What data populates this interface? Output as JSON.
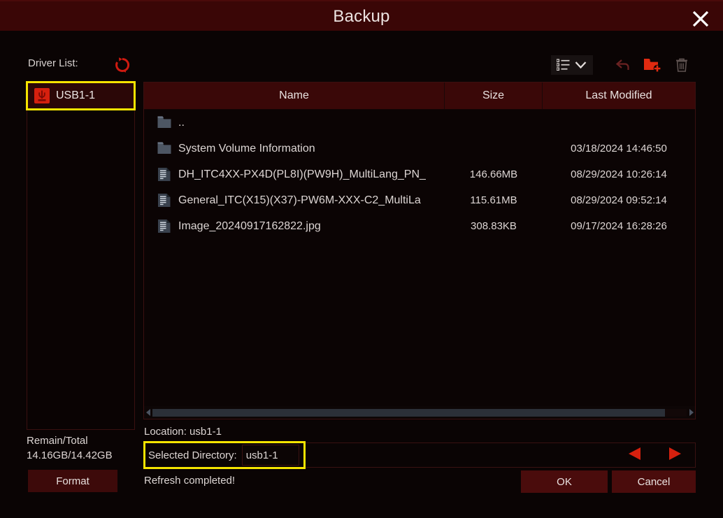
{
  "window": {
    "title": "Backup",
    "close_icon": "close-icon"
  },
  "driver": {
    "label": "Driver List:",
    "refresh_icon": "refresh-icon",
    "items": [
      {
        "label": "USB1-1",
        "icon": "usb-icon",
        "selected": true
      }
    ],
    "remain_label": "Remain/Total",
    "remain_value": "14.16GB/14.42GB",
    "format_label": "Format"
  },
  "toolbar": {
    "viewmode_icon": "list-view-icon",
    "viewmode_chevron": "chevron-down-icon",
    "back_icon": "back-arrow-icon",
    "new_folder_icon": "new-folder-icon",
    "delete_icon": "trash-icon"
  },
  "table": {
    "headers": [
      "Name",
      "Size",
      "Last Modified"
    ],
    "rows": [
      {
        "icon": "folder-icon",
        "name": "..",
        "size": "",
        "modified": ""
      },
      {
        "icon": "folder-icon",
        "name": "System Volume Information",
        "size": "",
        "modified": "03/18/2024 14:46:50"
      },
      {
        "icon": "file-icon",
        "name": "DH_ITC4XX-PX4D(PL8I)(PW9H)_MultiLang_PN_",
        "size": "146.66MB",
        "modified": "08/29/2024 10:26:14"
      },
      {
        "icon": "file-icon",
        "name": "General_ITC(X15)(X37)-PW6M-XXX-C2_MultiLa",
        "size": "115.61MB",
        "modified": "08/29/2024 09:52:14"
      },
      {
        "icon": "file-icon",
        "name": "Image_20240917162822.jpg",
        "size": "308.83KB",
        "modified": "09/17/2024 16:28:26"
      }
    ],
    "scroll_left_icon": "scroll-left-arrow-icon",
    "scroll_right_icon": "scroll-right-arrow-icon"
  },
  "footer": {
    "location": "Location: usb1-1",
    "selected_dir_label": "Selected Directory:",
    "selected_dir_value": "usb1-1",
    "selected_dir_placeholder": "",
    "status": "Refresh completed!",
    "prev_icon": "prev-arrow-icon",
    "next_icon": "next-arrow-icon",
    "ok_label": "OK",
    "cancel_label": "Cancel"
  },
  "colors": {
    "titlebar": "#3a0606",
    "accent_red": "#cf1a10",
    "highlight_yellow": "#f5e400",
    "header_row": "#3a0808",
    "button": "#4a0c0c",
    "text": "#ddd6d4"
  }
}
